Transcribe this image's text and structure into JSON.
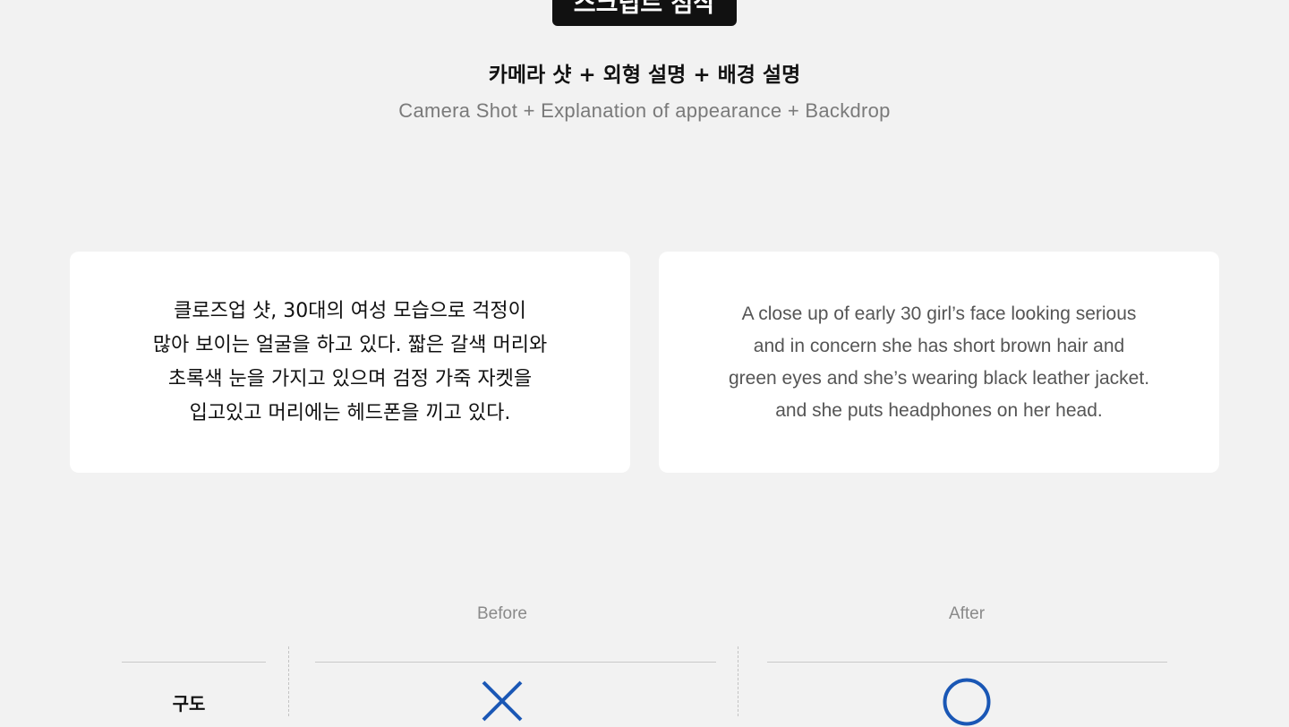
{
  "header": {
    "badge_label": "스크립트 첨삭",
    "title_ko": "카메라 샷 + 외형 설명 + 배경 설명",
    "title_en": "Camera Shot + Explanation of appearance + Backdrop"
  },
  "cards": {
    "korean_text": "클로즈업 샷, 30대의 여성 모습으로 걱정이\n많아 보이는 얼굴을 하고 있다. 짧은 갈색 머리와\n초록색 눈을 가지고 있으며 검정 가죽 자켓을\n입고있고 머리에는 헤드폰을 끼고 있다.",
    "english_text": "A close up of early 30 girl’s face looking serious\nand in concern she has short brown hair and\ngreen eyes and she’s wearing black leather jacket.\nand she puts headphones on her head."
  },
  "comparison": {
    "before_label": "Before",
    "after_label": "After",
    "rows": [
      {
        "label": "구도",
        "before_icon": "x-mark-icon",
        "after_icon": "circle-o-icon"
      }
    ]
  },
  "colors": {
    "background": "#f2f2f2",
    "badge": "#111111",
    "mark_blue": "#1a57b5"
  }
}
